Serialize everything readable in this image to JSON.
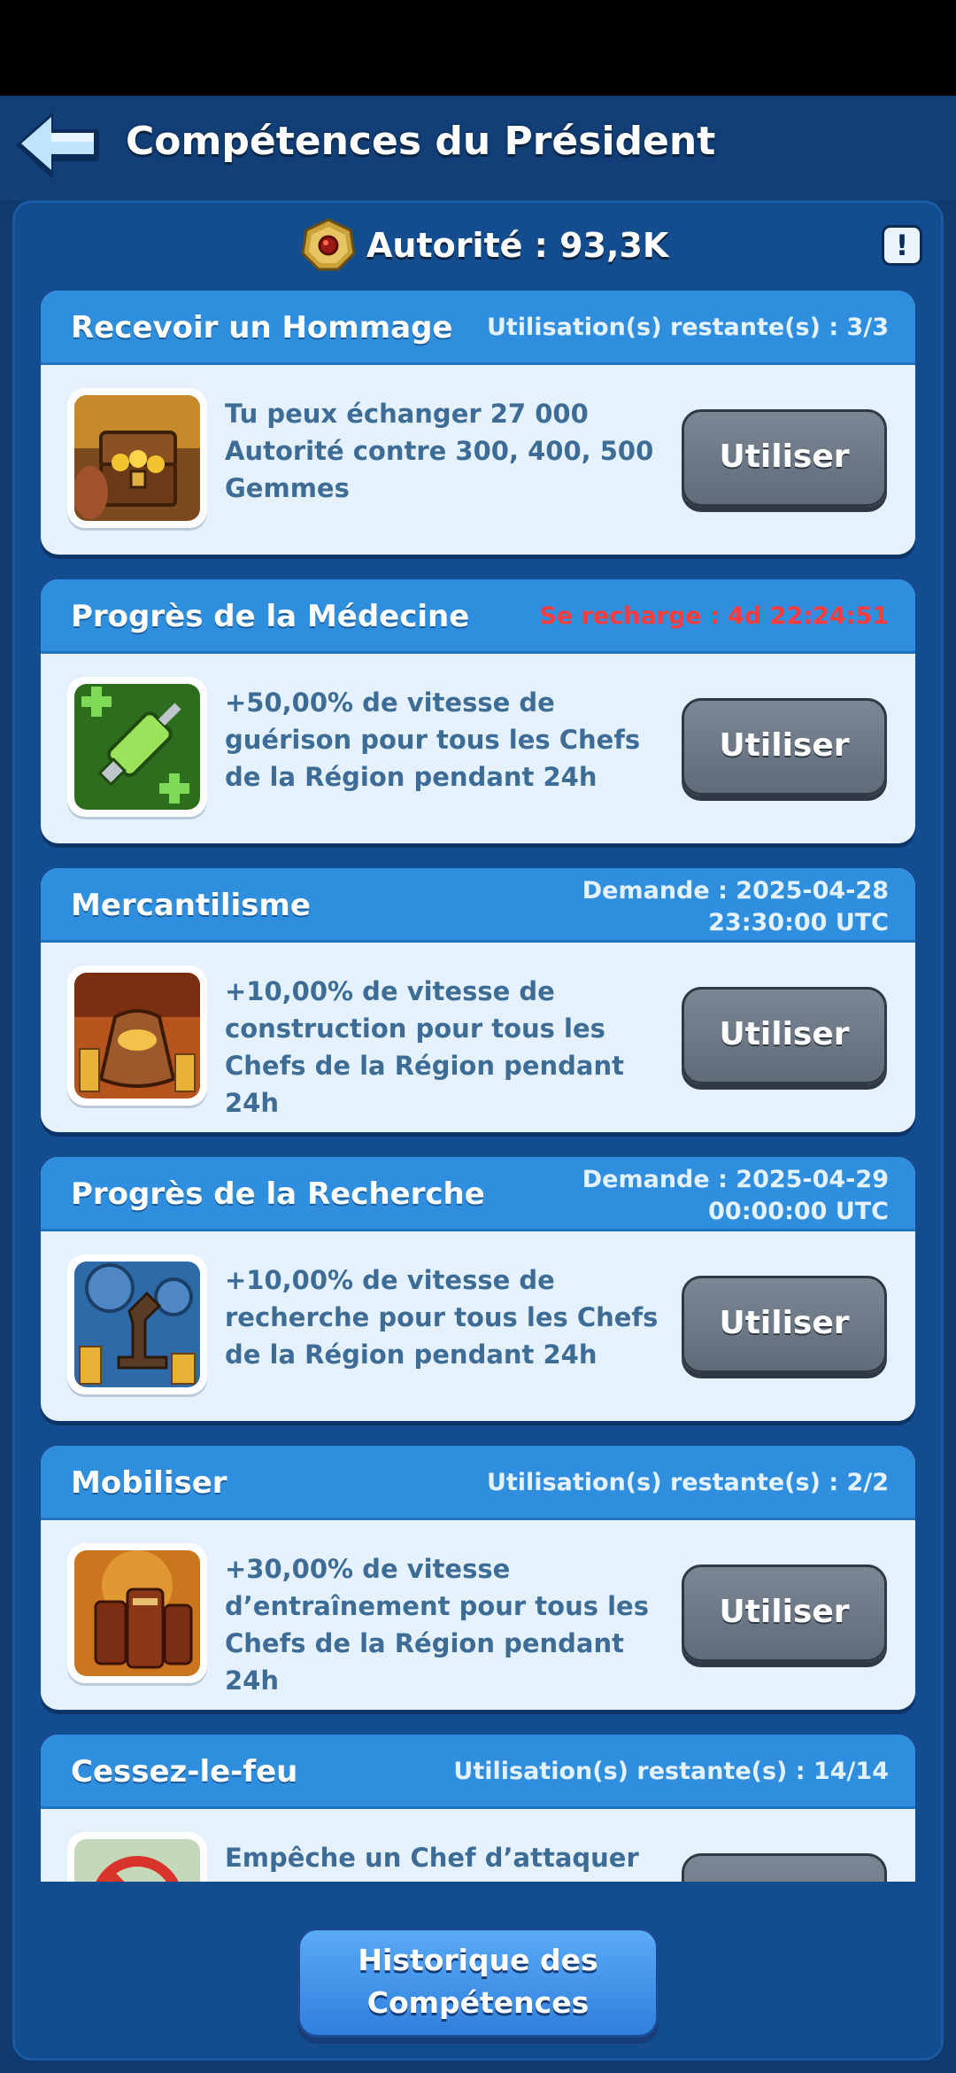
{
  "header": {
    "title": "Compétences du Président",
    "back_icon": "arrow-left-icon"
  },
  "authority": {
    "icon": "authority-medal-icon",
    "text": "Autorité : 93,3K"
  },
  "info_icon": "exclamation-icon",
  "info_glyph": "!",
  "skills": [
    {
      "name": "Recevoir un Hommage",
      "status": "Utilisation(s) restante(s) : 3/3",
      "status_line2": "",
      "icon": "treasure-chest-icon",
      "description": "Tu peux échanger 27 000 Autorité contre 300, 400, 500 Gemmes",
      "button": "Utiliser"
    },
    {
      "name": "Progrès de la Médecine",
      "status": "Se recharge : 4d 22:24:51",
      "status_line2": "",
      "icon": "syringe-icon",
      "description": "+50,00% de vitesse de guérison pour tous les Chefs de la Région pendant 24h",
      "button": "Utiliser"
    },
    {
      "name": "Mercantilisme",
      "status": "Demande : 2025-04-28",
      "status_line2": "23:30:00 UTC",
      "icon": "money-bag-icon",
      "description": "+10,00% de vitesse de construction pour tous les Chefs de la Région pendant 24h",
      "button": "Utiliser"
    },
    {
      "name": "Progrès de la Recherche",
      "status": "Demande : 2025-04-29",
      "status_line2": "00:00:00 UTC",
      "icon": "microscope-icon",
      "description": "+10,00% de vitesse de recherche pour tous les Chefs de la Région pendant 24h",
      "button": "Utiliser"
    },
    {
      "name": "Mobiliser",
      "status": "Utilisation(s) restante(s) : 2/2",
      "status_line2": "",
      "icon": "soldiers-icon",
      "description": "+30,00% de vitesse d’entraînement pour tous les Chefs de la Région pendant 24h",
      "button": "Utiliser"
    },
    {
      "name": "Cessez-le-feu",
      "status": "Utilisation(s) restante(s) : 14/14",
      "status_line2": "",
      "icon": "no-attack-icon",
      "description": "Empêche un Chef d’attaquer les",
      "button": ""
    }
  ],
  "history_button": {
    "line1": "Historique des",
    "line2": "Compétences"
  },
  "colors": {
    "header_bar": "#2f8fde",
    "card_bg": "#e5f2fd",
    "panel": "#144d8f",
    "cooldown_red": "#ff3b3b",
    "use_button": "#6b7684"
  }
}
